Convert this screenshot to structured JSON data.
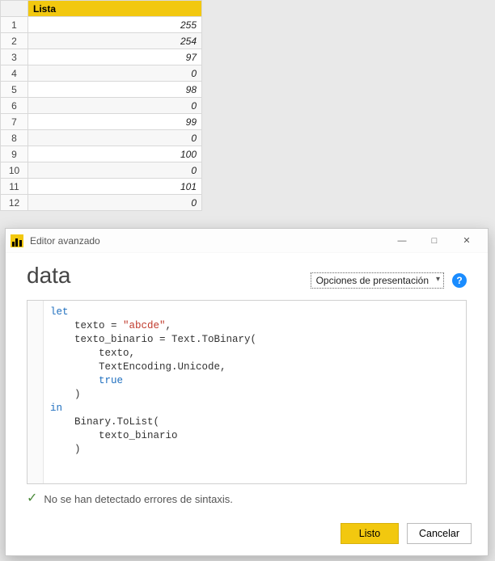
{
  "table": {
    "column_header": "Lista",
    "rows": [
      {
        "idx": 1,
        "value": 255
      },
      {
        "idx": 2,
        "value": 254
      },
      {
        "idx": 3,
        "value": 97
      },
      {
        "idx": 4,
        "value": 0
      },
      {
        "idx": 5,
        "value": 98
      },
      {
        "idx": 6,
        "value": 0
      },
      {
        "idx": 7,
        "value": 99
      },
      {
        "idx": 8,
        "value": 0
      },
      {
        "idx": 9,
        "value": 100
      },
      {
        "idx": 10,
        "value": 0
      },
      {
        "idx": 11,
        "value": 101
      },
      {
        "idx": 12,
        "value": 0
      }
    ]
  },
  "dialog": {
    "window_title": "Editor avanzado",
    "query_title": "data",
    "display_options_label": "Opciones de presentación",
    "help_glyph": "?",
    "minimize_glyph": "—",
    "maximize_glyph": "□",
    "close_glyph": "✕",
    "code": {
      "tokens": [
        {
          "t": "kw",
          "v": "let"
        },
        {
          "t": "plain",
          "v": "\n    texto = "
        },
        {
          "t": "str",
          "v": "\"abcde\""
        },
        {
          "t": "plain",
          "v": ",\n    texto_binario = Text.ToBinary(\n        texto,\n        TextEncoding.Unicode,\n        "
        },
        {
          "t": "kw",
          "v": "true"
        },
        {
          "t": "plain",
          "v": "\n    )\n"
        },
        {
          "t": "kw",
          "v": "in"
        },
        {
          "t": "plain",
          "v": "\n    Binary.ToList(\n        texto_binario\n    )"
        }
      ]
    },
    "status_text": "No se han detectado errores de sintaxis.",
    "check_glyph": "✓",
    "done_label": "Listo",
    "cancel_label": "Cancelar"
  }
}
